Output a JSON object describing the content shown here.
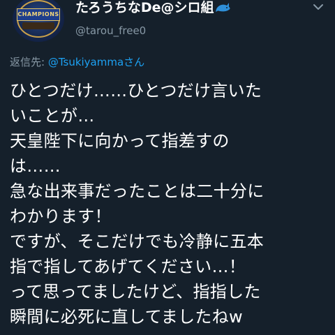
{
  "tweet": {
    "display_name": "たろうちなDe@シロ組",
    "display_name_emoji_icon": "dolphin-icon",
    "handle": "@tarou_free0",
    "avatar_icon": "champions-trophy-avatar",
    "reply_label": "返信先: ",
    "reply_user": "@Tsukiyammaさん",
    "lines": [
      "ひとつだけ……ひとつだけ言いた",
      "いことが…",
      "天皇陛下に向かって指差すの",
      "は……",
      "急な出来事だったことは二十分に",
      "わかります！",
      "ですが、そこだけでも冷静に五本",
      "指で指してあげてください…！",
      "って思ってましたけど、指指した",
      "瞬間に必死に直してましたねw"
    ]
  },
  "avatar_text": "CHAMPIONS",
  "colors": {
    "background": "#15202b",
    "primary_text": "#ffffff",
    "secondary_text": "#8899a6",
    "link": "#1da1f2",
    "emoji_blue": "#2e8fd8"
  }
}
